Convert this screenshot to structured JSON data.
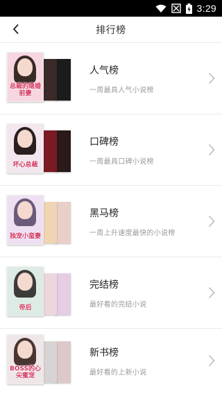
{
  "status_bar": {
    "time": "3:29"
  },
  "header": {
    "title": "排行榜"
  },
  "rankings": [
    {
      "title": "人气榜",
      "subtitle": "一周最具人气小说榜",
      "cover_text": "总裁的隐婚前妻",
      "cover_colors": [
        "#f7d6e0",
        "#3b2a2a",
        "#1c1c1c"
      ]
    },
    {
      "title": "口碑榜",
      "subtitle": "一周最具口碑小说榜",
      "cover_text": "坏心总裁",
      "cover_colors": [
        "#f3e7ef",
        "#7a1a22",
        "#2a1a1a"
      ]
    },
    {
      "title": "黑马榜",
      "subtitle": "一周上升速度最快的小说榜",
      "cover_text": "独宠小蛮妻",
      "cover_colors": [
        "#eee0f2",
        "#f0d5b5",
        "#e8d0c8"
      ]
    },
    {
      "title": "完结榜",
      "subtitle": "最好看的完结小说",
      "cover_text": "帝后",
      "cover_colors": [
        "#dcebe3",
        "#ecd8dc",
        "#e6cde3"
      ]
    },
    {
      "title": "新书榜",
      "subtitle": "最好看的上新小说",
      "cover_text": "BOSS的心尖蜜宠",
      "cover_colors": [
        "#efe6e8",
        "#d9d4d4",
        "#ddc9c9"
      ]
    }
  ]
}
